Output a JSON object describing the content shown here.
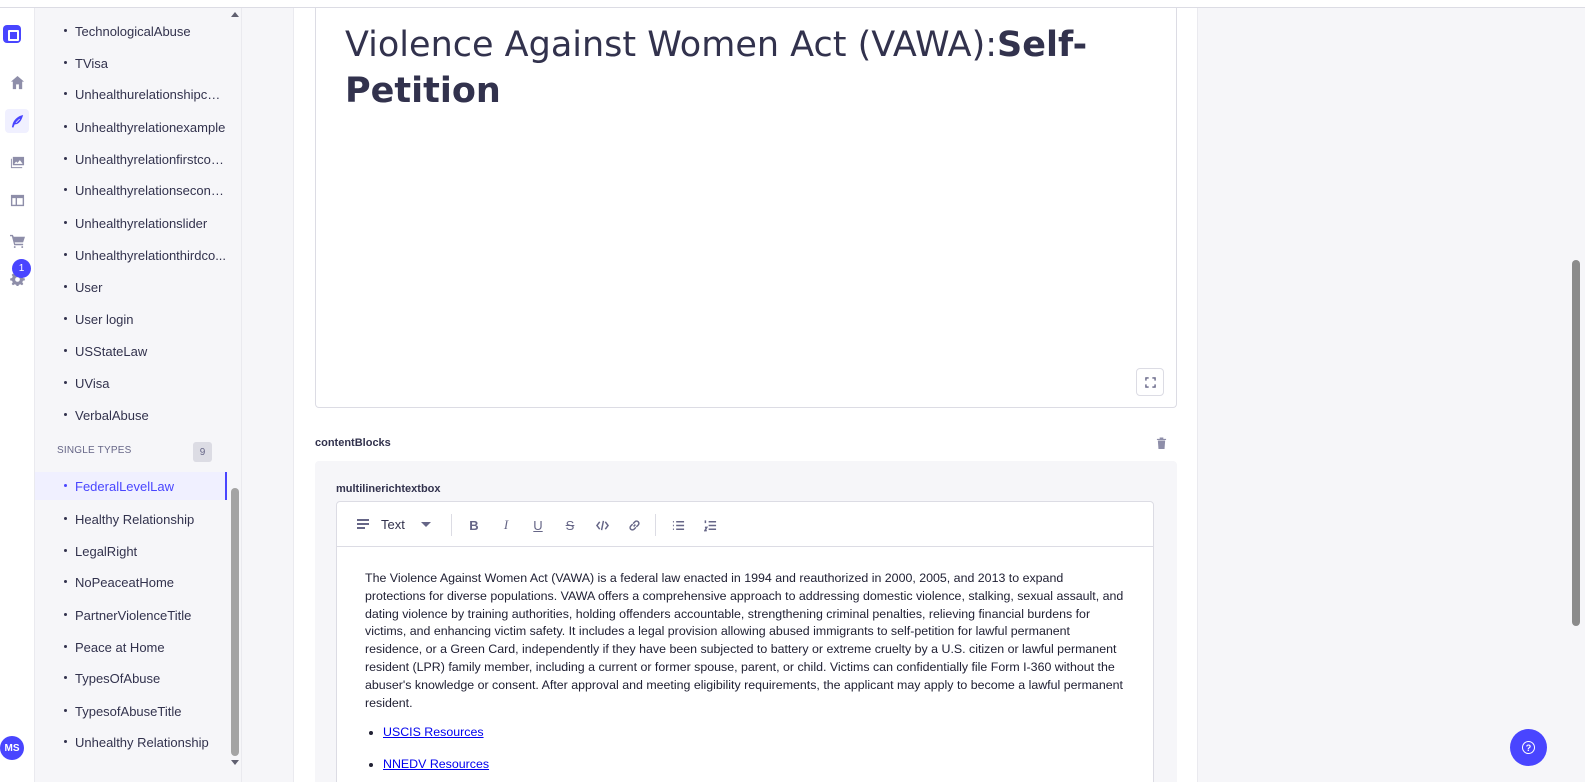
{
  "colors": {
    "accent": "#4945ff",
    "text": "#32324d",
    "muted": "#666687",
    "link": "#0000ee"
  },
  "rail": {
    "icons": [
      "logo-icon",
      "home-icon",
      "content-manager-icon",
      "media-library-icon",
      "content-type-builder-icon",
      "marketplace-icon",
      "settings-icon"
    ],
    "settings_badge": "1",
    "avatar_initials": "MS"
  },
  "sidebar": {
    "collection_items": [
      "TechnologicalAbuse",
      "TVisa",
      "Unhealthurelationshipcon...",
      "Unhealthyrelationexample",
      "Unhealthyrelationfirstcon...",
      "Unhealthyrelationsecond...",
      "Unhealthyrelationslider",
      "Unhealthyrelationthirdco...",
      "User",
      "User login",
      "USStateLaw",
      "UVisa",
      "VerbalAbuse"
    ],
    "single_types_label": "SINGLE TYPES",
    "single_types_count": "9",
    "single_items": [
      "FederalLevelLaw",
      "Healthy Relationship",
      "LegalRight",
      "NoPeaceatHome",
      "PartnerViolenceTitle",
      "Peace at Home",
      "TypesOfAbuse",
      "TypesofAbuseTitle",
      "Unhealthy Relationship"
    ],
    "active_item": "FederalLevelLaw"
  },
  "title_field": {
    "title_normal": "Violence Against Women Act (VAWA):",
    "title_bold": "Self-Petition"
  },
  "content_blocks": {
    "label": "contentBlocks",
    "component_label": "multilinerichtextbox",
    "toolbar": {
      "block_type": "Text",
      "buttons": [
        "bold-icon",
        "italic-icon",
        "underline-icon",
        "strikethrough-icon",
        "code-icon",
        "link-icon",
        "bulleted-list-icon",
        "numbered-list-icon"
      ]
    },
    "paragraph": "The Violence Against Women Act (VAWA) is a federal law enacted in 1994 and reauthorized in  2000, 2005, and 2013 to expand protections for diverse populations. VAWA offers a  comprehensive approach to addressing domestic violence, stalking, sexual assault, and dating  violence by training authorities, holding offenders accountable, strengthening criminal penalties,  relieving financial burdens for victims, and enhancing victim safety. It includes a legal provision  allowing abused immigrants to self-petition for lawful permanent residence, or a Green Card,  independently if they have been subjected to battery or extreme cruelty by a U.S. citizen or  lawful permanent resident (LPR) family member, including a current or former spouse, parent, or  child. Victims can confidentially file Form I-360 without the abuser's knowledge or consent.  After approval and meeting eligibility requirements, the applicant may apply to become a lawful permanent resident.",
    "links": [
      "USCIS Resources",
      "NNEDV Resources"
    ]
  }
}
